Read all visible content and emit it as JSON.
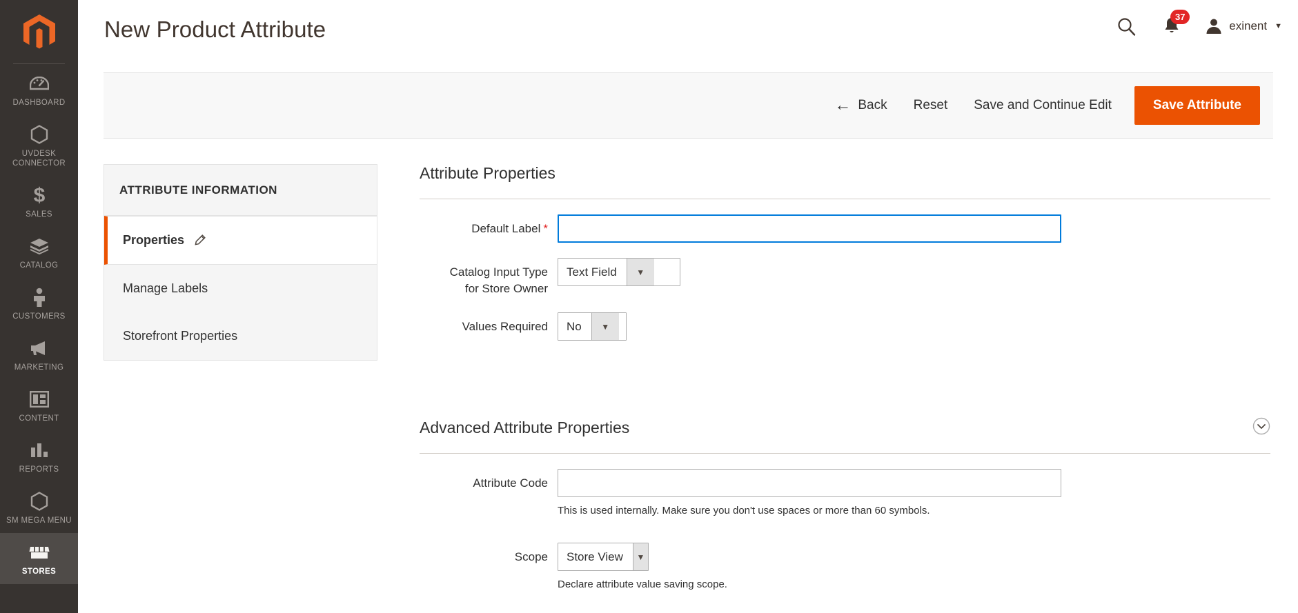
{
  "header": {
    "title": "New Product Attribute",
    "search_icon": "search-icon",
    "notifications_icon": "bell-icon",
    "notifications_count": "37",
    "user_icon": "user-avatar-icon",
    "user_name": "exinent",
    "user_caret": "▼"
  },
  "sidebar": {
    "logo": "magento-logo",
    "items": [
      {
        "label": "Dashboard",
        "icon": "dashboard-gauge-icon",
        "active": false
      },
      {
        "label": "UVdesk Connector",
        "icon": "hexagon-icon",
        "active": false
      },
      {
        "label": "Sales",
        "icon": "dollar-icon",
        "active": false
      },
      {
        "label": "Catalog",
        "icon": "box-icon",
        "active": false
      },
      {
        "label": "Customers",
        "icon": "person-icon",
        "active": false
      },
      {
        "label": "Marketing",
        "icon": "megaphone-icon",
        "active": false
      },
      {
        "label": "Content",
        "icon": "layout-icon",
        "active": false
      },
      {
        "label": "Reports",
        "icon": "bar-chart-icon",
        "active": false
      },
      {
        "label": "SM Mega Menu",
        "icon": "hexagon-icon",
        "active": false
      },
      {
        "label": "Stores",
        "icon": "storefront-icon",
        "active": true
      }
    ]
  },
  "toolbar": {
    "back_label": "Back",
    "back_icon": "arrow-left-icon",
    "reset_label": "Reset",
    "save_continue_label": "Save and Continue Edit",
    "save_attribute_label": "Save Attribute"
  },
  "tabs_panel": {
    "title": "ATTRIBUTE INFORMATION",
    "items": [
      {
        "label": "Properties",
        "active": true,
        "icon": "pencil-icon"
      },
      {
        "label": "Manage Labels",
        "active": false,
        "icon": ""
      },
      {
        "label": "Storefront Properties",
        "active": false,
        "icon": ""
      }
    ]
  },
  "form": {
    "attribute_properties": {
      "heading": "Attribute Properties",
      "default_label": {
        "label": "Default Label",
        "required_marker": "*",
        "value": "",
        "focused": true
      },
      "catalog_input_type": {
        "label_line1": "Catalog Input Type",
        "label_line2": "for Store Owner",
        "value": "Text Field",
        "arrow": "▼"
      },
      "values_required": {
        "label": "Values Required",
        "value": "No",
        "arrow": "▼"
      }
    },
    "advanced_attribute_properties": {
      "heading": "Advanced Attribute Properties",
      "collapse_icon": "chevron-down-circle-icon",
      "attribute_code": {
        "label": "Attribute Code",
        "value": "",
        "hint": "This is used internally. Make sure you don't use spaces or more than 60 symbols."
      },
      "scope": {
        "label": "Scope",
        "value": "Store View",
        "arrow": "▼",
        "hint": "Declare attribute value saving scope."
      }
    }
  },
  "colors": {
    "accent_orange": "#eb5202",
    "sidebar_bg": "#373330",
    "sidebar_active_bg": "#4f4b48",
    "badge_red": "#e22626",
    "focus_blue": "#007bdb"
  }
}
